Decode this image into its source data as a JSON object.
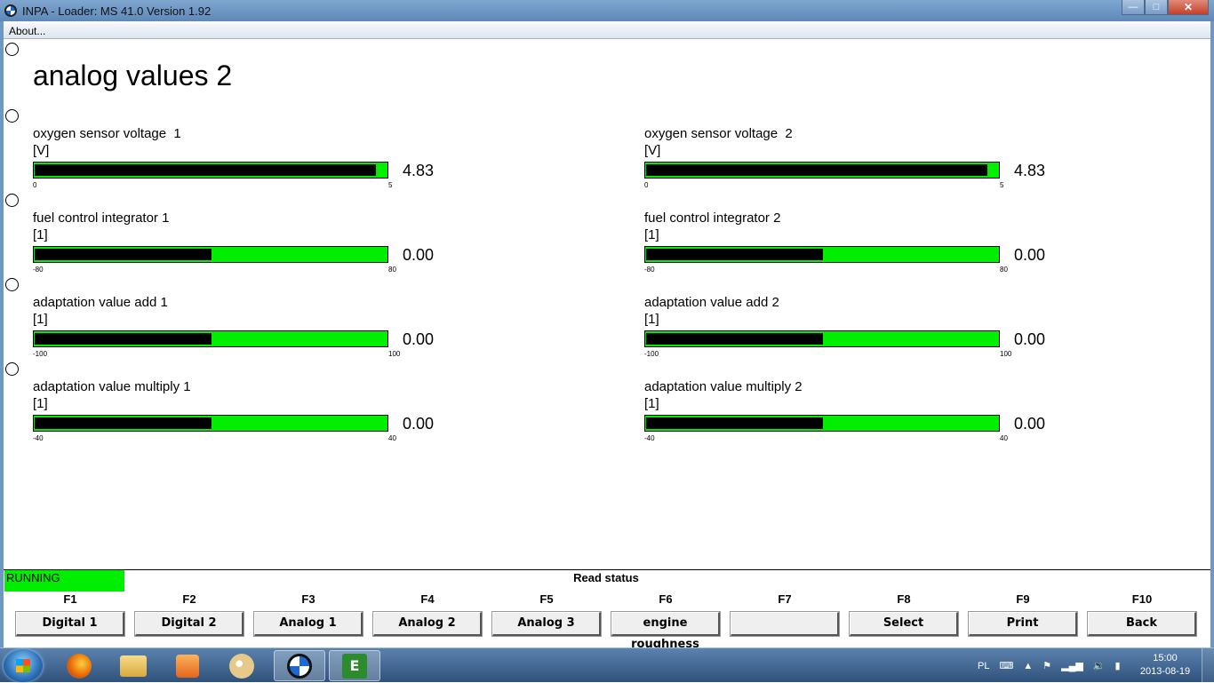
{
  "window": {
    "title": "INPA - Loader:  MS 41.0 Version 1.92",
    "minimize": "—",
    "maximize": "□",
    "close": "✕"
  },
  "menu": {
    "about": "About..."
  },
  "page": {
    "title": "analog values 2"
  },
  "gauges": [
    {
      "label": "oxygen sensor voltage  1",
      "unit": "[V]",
      "min": "0",
      "max": "5",
      "value": "4.83",
      "fraction": 0.966
    },
    {
      "label": "oxygen sensor voltage  2",
      "unit": "[V]",
      "min": "0",
      "max": "5",
      "value": "4.83",
      "fraction": 0.966
    },
    {
      "label": "fuel control integrator 1",
      "unit": "[1]",
      "min": "-80",
      "max": "80",
      "value": "0.00",
      "fraction": 0.5
    },
    {
      "label": "fuel control integrator 2",
      "unit": "[1]",
      "min": "-80",
      "max": "80",
      "value": "0.00",
      "fraction": 0.5
    },
    {
      "label": "adaptation value add 1",
      "unit": "[1]",
      "min": "-100",
      "max": "100",
      "value": "0.00",
      "fraction": 0.5
    },
    {
      "label": "adaptation value add 2",
      "unit": "[1]",
      "min": "-100",
      "max": "100",
      "value": "0.00",
      "fraction": 0.5
    },
    {
      "label": "adaptation value multiply 1",
      "unit": "[1]",
      "min": "-40",
      "max": "40",
      "value": "0.00",
      "fraction": 0.5
    },
    {
      "label": "adaptation value multiply 2",
      "unit": "[1]",
      "min": "-40",
      "max": "40",
      "value": "0.00",
      "fraction": 0.5
    }
  ],
  "status": {
    "state": "RUNNING",
    "message": "Read status"
  },
  "fkeys": [
    {
      "key": "F1",
      "label": "Digital 1"
    },
    {
      "key": "F2",
      "label": "Digital 2"
    },
    {
      "key": "F3",
      "label": "Analog 1"
    },
    {
      "key": "F4",
      "label": "Analog 2"
    },
    {
      "key": "F5",
      "label": "Analog 3"
    },
    {
      "key": "F6",
      "label": "engine roughness"
    },
    {
      "key": "F7",
      "label": ""
    },
    {
      "key": "F8",
      "label": "Select"
    },
    {
      "key": "F9",
      "label": "Print"
    },
    {
      "key": "F10",
      "label": "Back"
    }
  ],
  "taskbar": {
    "apps": [
      "firefox-icon",
      "explorer-icon",
      "media-player-icon",
      "paint-icon",
      "bmw-inpa-icon",
      "ediabas-icon"
    ],
    "e_glyph": "E",
    "tray": {
      "language": "PL",
      "keyboard": "⌨",
      "arrow": "▲",
      "flag": "⚑",
      "signal": "▂▄▆",
      "volume": "🔉",
      "battery": "▮"
    },
    "time": "15:00",
    "date": "2013-08-19"
  },
  "colors": {
    "bar_green": "#00ee00",
    "bar_fill": "#000000",
    "running_green": "#00ee00"
  }
}
